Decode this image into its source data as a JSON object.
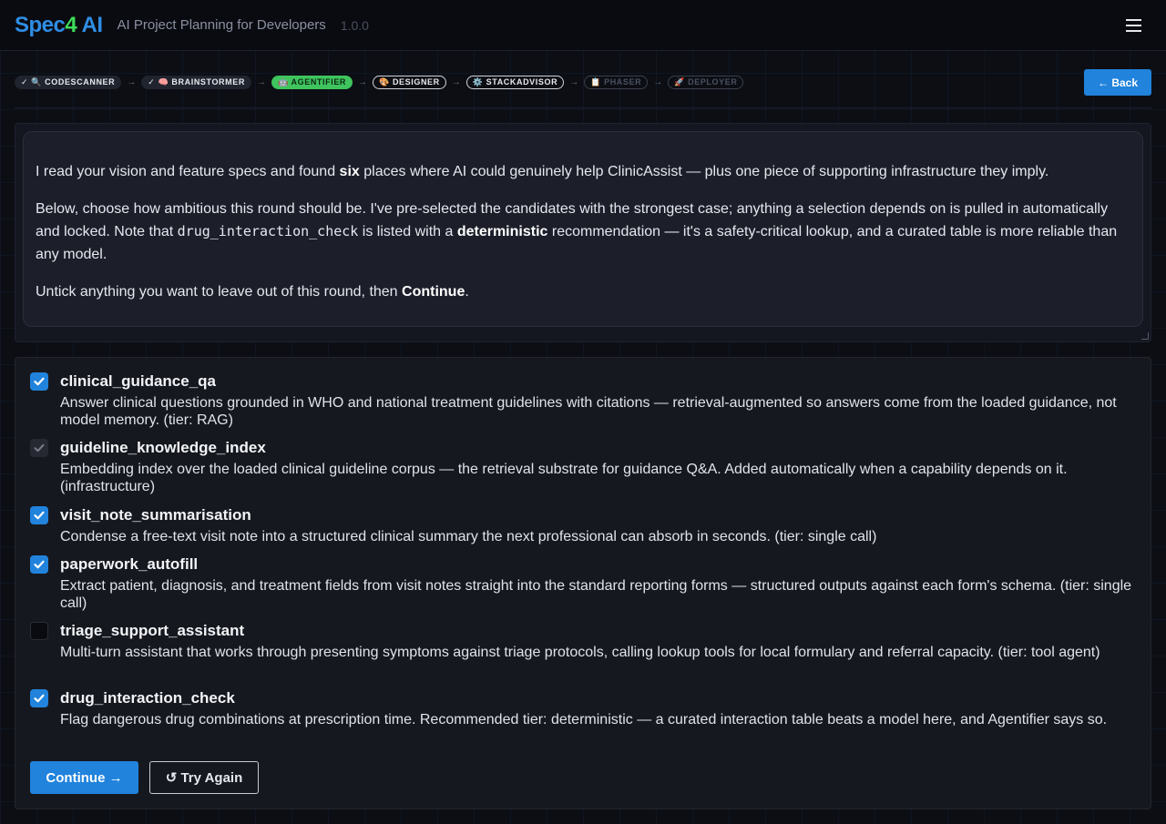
{
  "header": {
    "logo_part1": "Spec",
    "logo_part2": "4",
    "logo_part3": " AI",
    "tagline": "AI Project Planning for Developers",
    "version": "1.0.0",
    "menu_icon": "hamburger-menu-icon"
  },
  "steps": [
    {
      "label": "✓ 🔍 CODESCANNER",
      "state": "done"
    },
    {
      "label": "✓ 🧠 BRAINSTORMER",
      "state": "done"
    },
    {
      "label": "🤖 AGENTIFIER",
      "state": "active"
    },
    {
      "label": "🎨 DESIGNER",
      "state": "upcoming"
    },
    {
      "label": "⚙️ STACKADVISOR",
      "state": "upcoming"
    },
    {
      "label": "📋 PHASER",
      "state": "locked"
    },
    {
      "label": "🚀 DEPLOYER",
      "state": "locked"
    }
  ],
  "step_arrow": "→",
  "back_label": "← Back",
  "intro": {
    "p1_a": "I read your vision and feature specs and found ",
    "p1_b": "six",
    "p1_c": " places where AI could genuinely help ClinicAssist — plus one piece of supporting infrastructure they imply.",
    "p2_a": "Below, choose how ambitious this round should be. I've pre-selected the candidates with the strongest case; anything a selection depends on is pulled in automatically and locked. Note that ",
    "p2_code": "drug_interaction_check",
    "p2_b": " is listed with a ",
    "p2_c": "deterministic",
    "p2_d": " recommendation — it's a safety-critical lookup, and a curated table is more reliable than any model.",
    "p3_a": "Untick anything you want to leave out of this round, then ",
    "p3_b": "Continue",
    "p3_c": "."
  },
  "options": [
    {
      "title": "clinical_guidance_qa",
      "state": "checked",
      "desc": "Answer clinical questions grounded in WHO and national treatment guidelines with citations — retrieval-augmented so answers come from the loaded guidance, not model memory. (tier: RAG)"
    },
    {
      "title": "guideline_knowledge_index",
      "state": "locked",
      "desc": "Embedding index over the loaded clinical guideline corpus — the retrieval substrate for guidance Q&A. Added automatically when a capability depends on it. (infrastructure)"
    },
    {
      "title": "visit_note_summarisation",
      "state": "checked",
      "desc": "Condense a free-text visit note into a structured clinical summary the next professional can absorb in seconds. (tier: single call)"
    },
    {
      "title": "paperwork_autofill",
      "state": "checked",
      "desc": "Extract patient, diagnosis, and treatment fields from visit notes straight into the standard reporting forms — structured outputs against each form's schema. (tier: single call)"
    },
    {
      "title": "triage_support_assistant",
      "state": "unchecked",
      "desc": "Multi-turn assistant that works through presenting symptoms against triage protocols, calling lookup tools for local formulary and referral capacity. (tier: tool agent)"
    },
    {
      "title": "drug_interaction_check",
      "state": "checked",
      "desc": "Flag dangerous drug combinations at prescription time. Recommended tier: deterministic — a curated interaction table beats a model here, and Agentifier says so."
    }
  ],
  "actions": {
    "continue_label": "Continue →",
    "retry_label": "↺ Try Again"
  },
  "colors": {
    "accent": "#2183dc",
    "active_step": "#3fc45e",
    "logo_digit": "#3ddc5a"
  }
}
